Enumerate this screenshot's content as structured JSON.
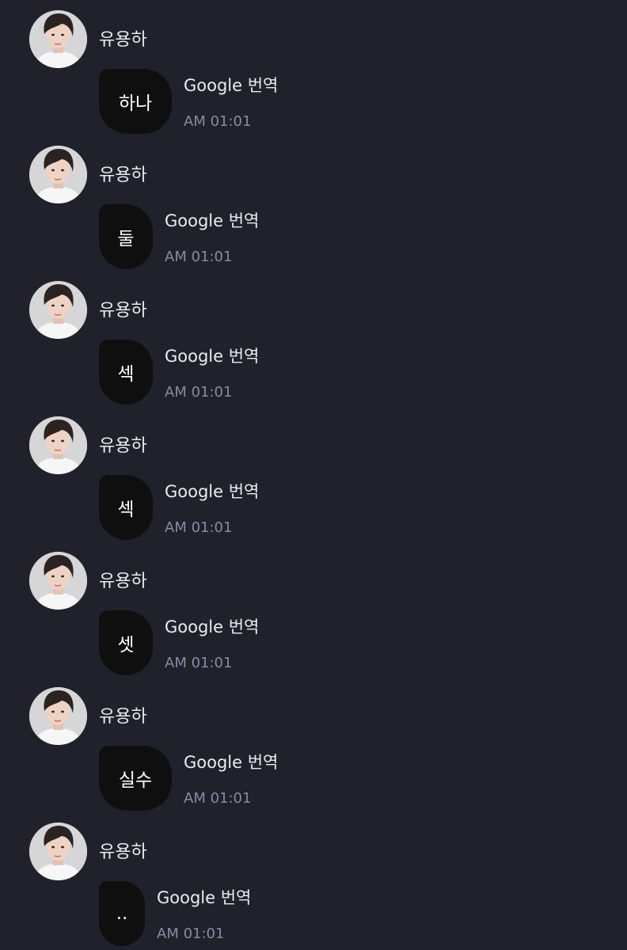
{
  "chat": {
    "messages": [
      {
        "sender": "유용하",
        "text": "하나",
        "action": "Google 번역",
        "time": "AM 01:01"
      },
      {
        "sender": "유용하",
        "text": "둘",
        "action": "Google 번역",
        "time": "AM 01:01"
      },
      {
        "sender": "유용하",
        "text": "섹",
        "action": "Google 번역",
        "time": "AM 01:01"
      },
      {
        "sender": "유용하",
        "text": "섹",
        "action": "Google 번역",
        "time": "AM 01:01"
      },
      {
        "sender": "유용하",
        "text": "셋",
        "action": "Google 번역",
        "time": "AM 01:01"
      },
      {
        "sender": "유용하",
        "text": "실수",
        "action": "Google 번역",
        "time": "AM 01:01"
      },
      {
        "sender": "유용하",
        "text": "..",
        "action": "Google 번역",
        "time": "AM 01:01"
      }
    ]
  },
  "colors": {
    "background": "#20212b",
    "bubble": "#0f0f10",
    "text": "#ececef",
    "time": "#8b88a5"
  },
  "icons": {
    "avatar": "profile-photo-icon"
  }
}
